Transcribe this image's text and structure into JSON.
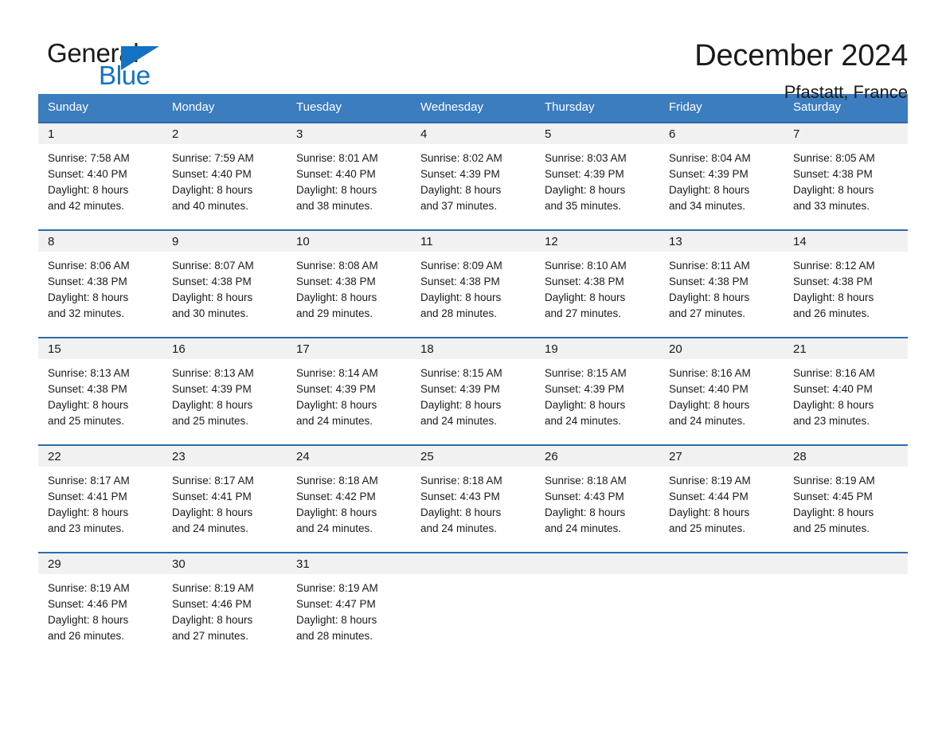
{
  "brand": {
    "name_part1": "General",
    "name_part2": "Blue",
    "triangle_color": "#1372c4",
    "text_color": "#1a1a1a"
  },
  "header": {
    "title": "December 2024",
    "location": "Pfastatt, France"
  },
  "theme": {
    "header_bg": "#3b7dbf",
    "header_text": "#ffffff",
    "row_divider": "#2e6ca8",
    "daynum_bg": "#f1f1f1",
    "body_text": "#1a1a1a"
  },
  "weekday_headers": [
    "Sunday",
    "Monday",
    "Tuesday",
    "Wednesday",
    "Thursday",
    "Friday",
    "Saturday"
  ],
  "weeks": [
    [
      {
        "day": "1",
        "sunrise": "Sunrise: 7:58 AM",
        "sunset": "Sunset: 4:40 PM",
        "daylight1": "Daylight: 8 hours",
        "daylight2": "and 42 minutes."
      },
      {
        "day": "2",
        "sunrise": "Sunrise: 7:59 AM",
        "sunset": "Sunset: 4:40 PM",
        "daylight1": "Daylight: 8 hours",
        "daylight2": "and 40 minutes."
      },
      {
        "day": "3",
        "sunrise": "Sunrise: 8:01 AM",
        "sunset": "Sunset: 4:40 PM",
        "daylight1": "Daylight: 8 hours",
        "daylight2": "and 38 minutes."
      },
      {
        "day": "4",
        "sunrise": "Sunrise: 8:02 AM",
        "sunset": "Sunset: 4:39 PM",
        "daylight1": "Daylight: 8 hours",
        "daylight2": "and 37 minutes."
      },
      {
        "day": "5",
        "sunrise": "Sunrise: 8:03 AM",
        "sunset": "Sunset: 4:39 PM",
        "daylight1": "Daylight: 8 hours",
        "daylight2": "and 35 minutes."
      },
      {
        "day": "6",
        "sunrise": "Sunrise: 8:04 AM",
        "sunset": "Sunset: 4:39 PM",
        "daylight1": "Daylight: 8 hours",
        "daylight2": "and 34 minutes."
      },
      {
        "day": "7",
        "sunrise": "Sunrise: 8:05 AM",
        "sunset": "Sunset: 4:38 PM",
        "daylight1": "Daylight: 8 hours",
        "daylight2": "and 33 minutes."
      }
    ],
    [
      {
        "day": "8",
        "sunrise": "Sunrise: 8:06 AM",
        "sunset": "Sunset: 4:38 PM",
        "daylight1": "Daylight: 8 hours",
        "daylight2": "and 32 minutes."
      },
      {
        "day": "9",
        "sunrise": "Sunrise: 8:07 AM",
        "sunset": "Sunset: 4:38 PM",
        "daylight1": "Daylight: 8 hours",
        "daylight2": "and 30 minutes."
      },
      {
        "day": "10",
        "sunrise": "Sunrise: 8:08 AM",
        "sunset": "Sunset: 4:38 PM",
        "daylight1": "Daylight: 8 hours",
        "daylight2": "and 29 minutes."
      },
      {
        "day": "11",
        "sunrise": "Sunrise: 8:09 AM",
        "sunset": "Sunset: 4:38 PM",
        "daylight1": "Daylight: 8 hours",
        "daylight2": "and 28 minutes."
      },
      {
        "day": "12",
        "sunrise": "Sunrise: 8:10 AM",
        "sunset": "Sunset: 4:38 PM",
        "daylight1": "Daylight: 8 hours",
        "daylight2": "and 27 minutes."
      },
      {
        "day": "13",
        "sunrise": "Sunrise: 8:11 AM",
        "sunset": "Sunset: 4:38 PM",
        "daylight1": "Daylight: 8 hours",
        "daylight2": "and 27 minutes."
      },
      {
        "day": "14",
        "sunrise": "Sunrise: 8:12 AM",
        "sunset": "Sunset: 4:38 PM",
        "daylight1": "Daylight: 8 hours",
        "daylight2": "and 26 minutes."
      }
    ],
    [
      {
        "day": "15",
        "sunrise": "Sunrise: 8:13 AM",
        "sunset": "Sunset: 4:38 PM",
        "daylight1": "Daylight: 8 hours",
        "daylight2": "and 25 minutes."
      },
      {
        "day": "16",
        "sunrise": "Sunrise: 8:13 AM",
        "sunset": "Sunset: 4:39 PM",
        "daylight1": "Daylight: 8 hours",
        "daylight2": "and 25 minutes."
      },
      {
        "day": "17",
        "sunrise": "Sunrise: 8:14 AM",
        "sunset": "Sunset: 4:39 PM",
        "daylight1": "Daylight: 8 hours",
        "daylight2": "and 24 minutes."
      },
      {
        "day": "18",
        "sunrise": "Sunrise: 8:15 AM",
        "sunset": "Sunset: 4:39 PM",
        "daylight1": "Daylight: 8 hours",
        "daylight2": "and 24 minutes."
      },
      {
        "day": "19",
        "sunrise": "Sunrise: 8:15 AM",
        "sunset": "Sunset: 4:39 PM",
        "daylight1": "Daylight: 8 hours",
        "daylight2": "and 24 minutes."
      },
      {
        "day": "20",
        "sunrise": "Sunrise: 8:16 AM",
        "sunset": "Sunset: 4:40 PM",
        "daylight1": "Daylight: 8 hours",
        "daylight2": "and 24 minutes."
      },
      {
        "day": "21",
        "sunrise": "Sunrise: 8:16 AM",
        "sunset": "Sunset: 4:40 PM",
        "daylight1": "Daylight: 8 hours",
        "daylight2": "and 23 minutes."
      }
    ],
    [
      {
        "day": "22",
        "sunrise": "Sunrise: 8:17 AM",
        "sunset": "Sunset: 4:41 PM",
        "daylight1": "Daylight: 8 hours",
        "daylight2": "and 23 minutes."
      },
      {
        "day": "23",
        "sunrise": "Sunrise: 8:17 AM",
        "sunset": "Sunset: 4:41 PM",
        "daylight1": "Daylight: 8 hours",
        "daylight2": "and 24 minutes."
      },
      {
        "day": "24",
        "sunrise": "Sunrise: 8:18 AM",
        "sunset": "Sunset: 4:42 PM",
        "daylight1": "Daylight: 8 hours",
        "daylight2": "and 24 minutes."
      },
      {
        "day": "25",
        "sunrise": "Sunrise: 8:18 AM",
        "sunset": "Sunset: 4:43 PM",
        "daylight1": "Daylight: 8 hours",
        "daylight2": "and 24 minutes."
      },
      {
        "day": "26",
        "sunrise": "Sunrise: 8:18 AM",
        "sunset": "Sunset: 4:43 PM",
        "daylight1": "Daylight: 8 hours",
        "daylight2": "and 24 minutes."
      },
      {
        "day": "27",
        "sunrise": "Sunrise: 8:19 AM",
        "sunset": "Sunset: 4:44 PM",
        "daylight1": "Daylight: 8 hours",
        "daylight2": "and 25 minutes."
      },
      {
        "day": "28",
        "sunrise": "Sunrise: 8:19 AM",
        "sunset": "Sunset: 4:45 PM",
        "daylight1": "Daylight: 8 hours",
        "daylight2": "and 25 minutes."
      }
    ],
    [
      {
        "day": "29",
        "sunrise": "Sunrise: 8:19 AM",
        "sunset": "Sunset: 4:46 PM",
        "daylight1": "Daylight: 8 hours",
        "daylight2": "and 26 minutes."
      },
      {
        "day": "30",
        "sunrise": "Sunrise: 8:19 AM",
        "sunset": "Sunset: 4:46 PM",
        "daylight1": "Daylight: 8 hours",
        "daylight2": "and 27 minutes."
      },
      {
        "day": "31",
        "sunrise": "Sunrise: 8:19 AM",
        "sunset": "Sunset: 4:47 PM",
        "daylight1": "Daylight: 8 hours",
        "daylight2": "and 28 minutes."
      },
      {
        "day": "",
        "sunrise": "",
        "sunset": "",
        "daylight1": "",
        "daylight2": ""
      },
      {
        "day": "",
        "sunrise": "",
        "sunset": "",
        "daylight1": "",
        "daylight2": ""
      },
      {
        "day": "",
        "sunrise": "",
        "sunset": "",
        "daylight1": "",
        "daylight2": ""
      },
      {
        "day": "",
        "sunrise": "",
        "sunset": "",
        "daylight1": "",
        "daylight2": ""
      }
    ]
  ]
}
